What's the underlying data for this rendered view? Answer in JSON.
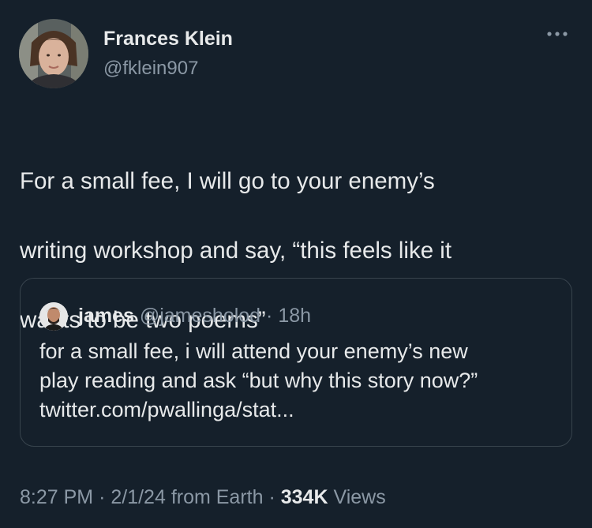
{
  "author": {
    "name": "Frances Klein",
    "handle": "@fklein907"
  },
  "icons": {
    "more": "more-horizontal-icon"
  },
  "tweet": {
    "lines": [
      "For a small fee, I will go to your enemy’s",
      "writing workshop and say, “this feels like it",
      "wants to be two poems”"
    ]
  },
  "quote": {
    "name": "james",
    "handle": "@jamesholod",
    "separator": "·",
    "time": "18h",
    "lines": [
      "for a small fee, i will attend your enemy’s new",
      "play reading and ask “but why this story now?”",
      "twitter.com/pwallinga/stat..."
    ]
  },
  "footer": {
    "time": "8:27 PM",
    "sep1": "·",
    "date": "2/1/24",
    "source": "from Earth",
    "sep2": "·",
    "views_count": "334K",
    "views_label": "Views"
  },
  "colors": {
    "background": "#15202b",
    "text_primary": "#e7e9ea",
    "text_secondary": "#8b98a5",
    "border": "#38444d"
  }
}
